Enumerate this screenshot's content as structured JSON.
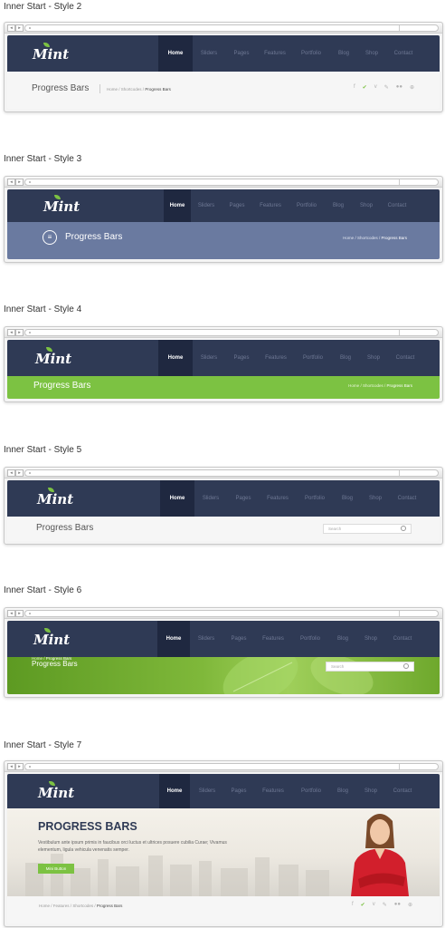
{
  "logo": "Mint",
  "menu": [
    "Home",
    "Sliders",
    "Pages",
    "Features",
    "Portfolio",
    "Blog",
    "Shop",
    "Contact"
  ],
  "page_title": "Progress Bars",
  "page_title_upper": "PROGRESS BARS",
  "search_placeholder": "Search",
  "crumbs3": {
    "c1": "Home",
    "c2": "Shortcodes",
    "c3": "Progress Bars"
  },
  "crumbs2": {
    "c1": "Home",
    "c2": "Features",
    "c3": "Shortcodes",
    "c4": "Progress Bars"
  },
  "social_icons": [
    "f",
    "✔",
    "v",
    "✎",
    "●●",
    "⊕"
  ],
  "style7": {
    "text": "Vestibulum ante ipsum primis in faucibus orci luctus et ultrices posuere cubilia Curae; Vivamus elementum, ligula vehicula venenatis semper.",
    "button": "Mini Button"
  },
  "sections": [
    {
      "title": "Inner Start - Style 2"
    },
    {
      "title": "Inner Start - Style 3"
    },
    {
      "title": "Inner Start - Style 4"
    },
    {
      "title": "Inner Start - Style 5"
    },
    {
      "title": "Inner Start - Style 6"
    },
    {
      "title": "Inner Start - Style 7"
    }
  ],
  "colors": {
    "navy": "#2f3a55",
    "green": "#7cc242",
    "slate": "#6a7aa0"
  }
}
